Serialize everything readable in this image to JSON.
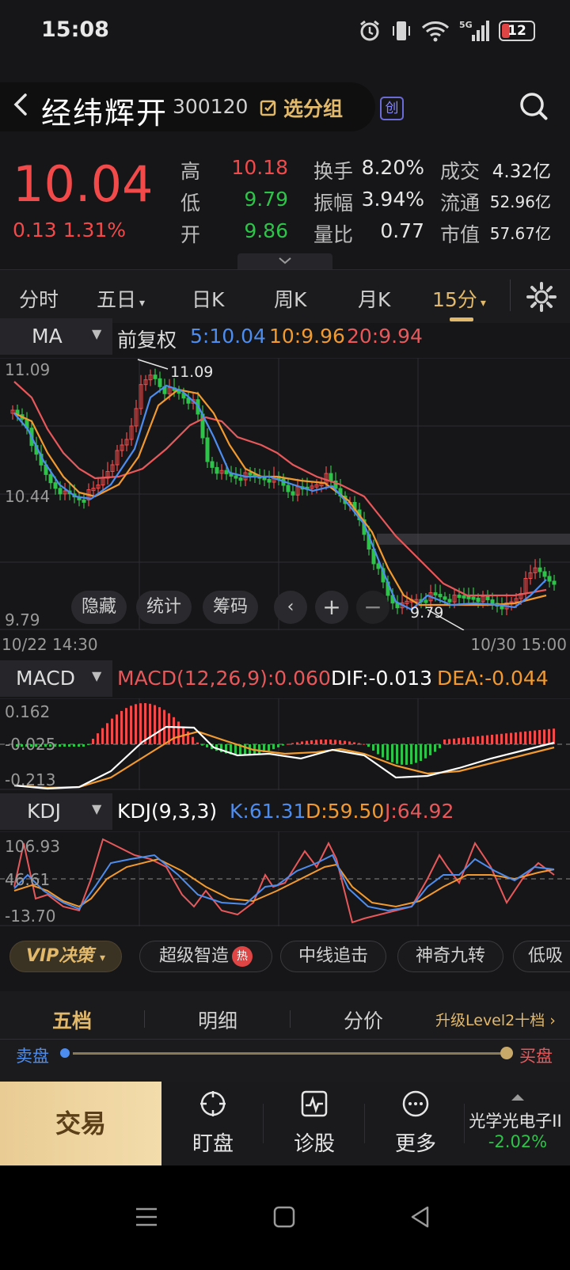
{
  "status_bar": {
    "time": "15:08",
    "battery": "12",
    "signal": "5G"
  },
  "header": {
    "stock_name": "经纬辉开",
    "stock_code": "300120",
    "select_group": "选分组",
    "board_badge": "创"
  },
  "quote": {
    "price": "10.04",
    "change": "0.13",
    "change_pct": "1.31%",
    "high_label": "高",
    "high": "10.18",
    "low_label": "低",
    "low": "9.79",
    "open_label": "开",
    "open": "9.86",
    "turnover_label": "换手",
    "turnover": "8.20%",
    "amplitude_label": "振幅",
    "amplitude": "3.94%",
    "vol_ratio_label": "量比",
    "vol_ratio": "0.77",
    "amount_label": "成交",
    "amount": "4.32亿",
    "float_label": "流通",
    "float_cap": "52.96亿",
    "mcap_label": "市值",
    "mcap": "57.67亿"
  },
  "tabs": [
    {
      "label": "分时"
    },
    {
      "label": "五日"
    },
    {
      "label": "日K"
    },
    {
      "label": "周K"
    },
    {
      "label": "月K"
    },
    {
      "label": "15分"
    }
  ],
  "ma_panel": {
    "indicator": "MA",
    "adjust": "前复权",
    "ma5": "5:10.04",
    "ma10": "10:9.96",
    "ma20": "20:9.94",
    "y_max": "11.09",
    "y_mid": "10.44",
    "y_min": "9.79",
    "hi_mark": "11.09",
    "lo_mark": "9.79",
    "x_start": "10/22 14:30",
    "x_end": "10/30 15:00",
    "buttons": {
      "hide": "隐藏",
      "stats": "统计",
      "chips": "筹码"
    }
  },
  "macd_panel": {
    "indicator": "MACD",
    "label": "MACD(12,26,9):0.060",
    "dif": "DIF:-0.013",
    "dea": "DEA:-0.044",
    "y_max": "0.162",
    "y_mid": "-0.025",
    "y_min": "-0.213"
  },
  "kdj_panel": {
    "indicator": "KDJ",
    "label": "KDJ(9,3,3)",
    "k": "K:61.31",
    "d": "D:59.50",
    "j": "J:64.92",
    "y_max": "106.93",
    "y_mid": "46.61",
    "y_min": "-13.70"
  },
  "chips": {
    "vip": "VIP决策",
    "items": [
      "超级智造",
      "中线追击",
      "神奇九转",
      "低吸"
    ],
    "hot": "热"
  },
  "five_levels": {
    "tabs": [
      "五档",
      "明细",
      "分价"
    ],
    "upgrade": "升级Level2十档",
    "sell": "卖盘",
    "buy": "买盘"
  },
  "bottom_bar": {
    "trade": "交易",
    "watch": "盯盘",
    "diagnose": "诊股",
    "more": "更多",
    "related_name": "光学光电子II",
    "related_change": "-2.02%"
  },
  "colors": {
    "up": "#f24a4a",
    "down": "#2ec44a",
    "ma5": "#4d8df0",
    "ma10": "#f29a2e",
    "ma20": "#e8585a",
    "gold": "#e2b96a"
  },
  "chart_data": {
    "type": "candlestick",
    "ylim": [
      9.79,
      11.09
    ],
    "x_range": [
      "10/22 14:30",
      "10/30 15:00"
    ],
    "ma_values": {
      "ma5": 10.04,
      "ma10": 9.96,
      "ma20": 9.94
    },
    "macd": {
      "macd": 0.06,
      "dif": -0.013,
      "dea": -0.044,
      "ylim": [
        -0.213,
        0.162
      ]
    },
    "kdj": {
      "k": 61.31,
      "d": 59.5,
      "j": 64.92,
      "ylim": [
        -13.7,
        106.93
      ]
    }
  }
}
